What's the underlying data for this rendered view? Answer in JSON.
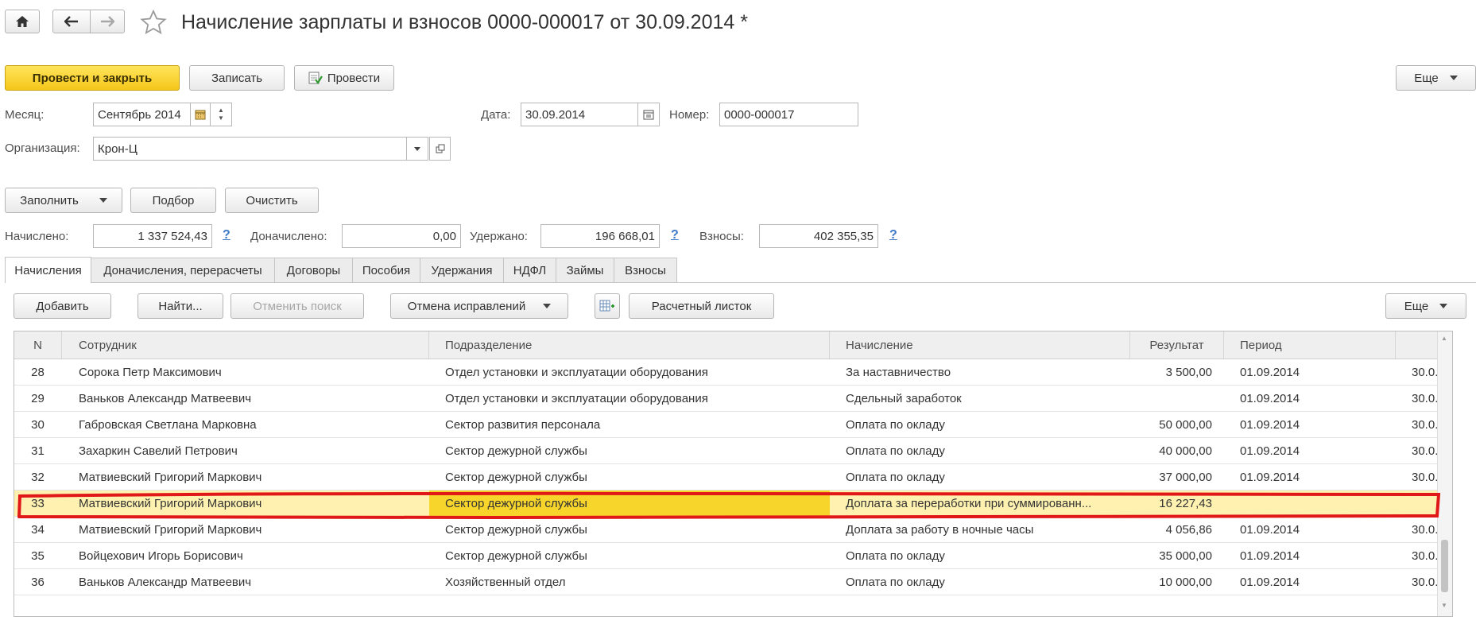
{
  "titlebar": {
    "title": "Начисление зарплаты и взносов 0000-000017 от 30.09.2014 *"
  },
  "toolbar": {
    "post_close": "Провести и закрыть",
    "save": "Записать",
    "post": "Провести",
    "more": "Еще"
  },
  "form": {
    "month_label": "Месяц:",
    "month_value": "Сентябрь 2014",
    "date_label": "Дата:",
    "date_value": "30.09.2014",
    "number_label": "Номер:",
    "number_value": "0000-000017",
    "org_label": "Организация:",
    "org_value": "Крон-Ц"
  },
  "actions": {
    "fill": "Заполнить",
    "pick": "Подбор",
    "clear": "Очистить"
  },
  "totals": {
    "accrued_label": "Начислено:",
    "accrued_value": "1 337 524,43",
    "extra_label": "Доначислено:",
    "extra_value": "0,00",
    "withheld_label": "Удержано:",
    "withheld_value": "196 668,01",
    "contrib_label": "Взносы:",
    "contrib_value": "402 355,35",
    "help": "?"
  },
  "tabs": [
    "Начисления",
    "Доначисления, перерасчеты",
    "Договоры",
    "Пособия",
    "Удержания",
    "НДФЛ",
    "Займы",
    "Взносы"
  ],
  "grid_toolbar": {
    "add": "Добавить",
    "find": "Найти...",
    "cancel_search": "Отменить поиск",
    "cancel_corrections": "Отмена исправлений",
    "payslip": "Расчетный листок",
    "more": "Еще"
  },
  "table": {
    "columns": [
      "N",
      "Сотрудник",
      "Подразделение",
      "Начисление",
      "Результат",
      "Период",
      ""
    ],
    "rows": [
      [
        "28",
        "Сорока Петр Максимович",
        "Отдел установки и эксплуатации оборудования",
        "За наставничество",
        "3 500,00",
        "01.09.2014",
        "30.0..."
      ],
      [
        "29",
        "Ваньков Александр Матвеевич",
        "Отдел установки и эксплуатации оборудования",
        "Сдельный заработок",
        "",
        "01.09.2014",
        "30.0..."
      ],
      [
        "30",
        "Габровская Светлана Марковна",
        "Сектор развития персонала",
        "Оплата по окладу",
        "50 000,00",
        "01.09.2014",
        "30.0..."
      ],
      [
        "31",
        "Захаркин Савелий Петрович",
        "Сектор дежурной службы",
        "Оплата по окладу",
        "40 000,00",
        "01.09.2014",
        "30.0..."
      ],
      [
        "32",
        "Матвиевский Григорий Маркович",
        "Сектор дежурной службы",
        "Оплата по окладу",
        "37 000,00",
        "01.09.2014",
        "30.0..."
      ],
      [
        "33",
        "Матвиевский Григорий Маркович",
        "Сектор дежурной службы",
        "Доплата за переработки при суммированн...",
        "16 227,43",
        "",
        ""
      ],
      [
        "34",
        "Матвиевский Григорий Маркович",
        "Сектор дежурной службы",
        "Доплата за работу в ночные часы",
        "4 056,86",
        "01.09.2014",
        "30.0..."
      ],
      [
        "35",
        "Войцехович Игорь Борисович",
        "Сектор дежурной службы",
        "Оплата по окладу",
        "35 000,00",
        "01.09.2014",
        "30.0..."
      ],
      [
        "36",
        "Ваньков Александр Матвеевич",
        "Хозяйственный отдел",
        "Оплата по окладу",
        "10 000,00",
        "01.09.2014",
        "30.0..."
      ]
    ],
    "selected_row": 5
  },
  "colors": {
    "primary": "#f5c71a",
    "selected_row": "#fff2b0",
    "selected_cell": "#f8d52b",
    "highlight_outline": "#e01818"
  }
}
